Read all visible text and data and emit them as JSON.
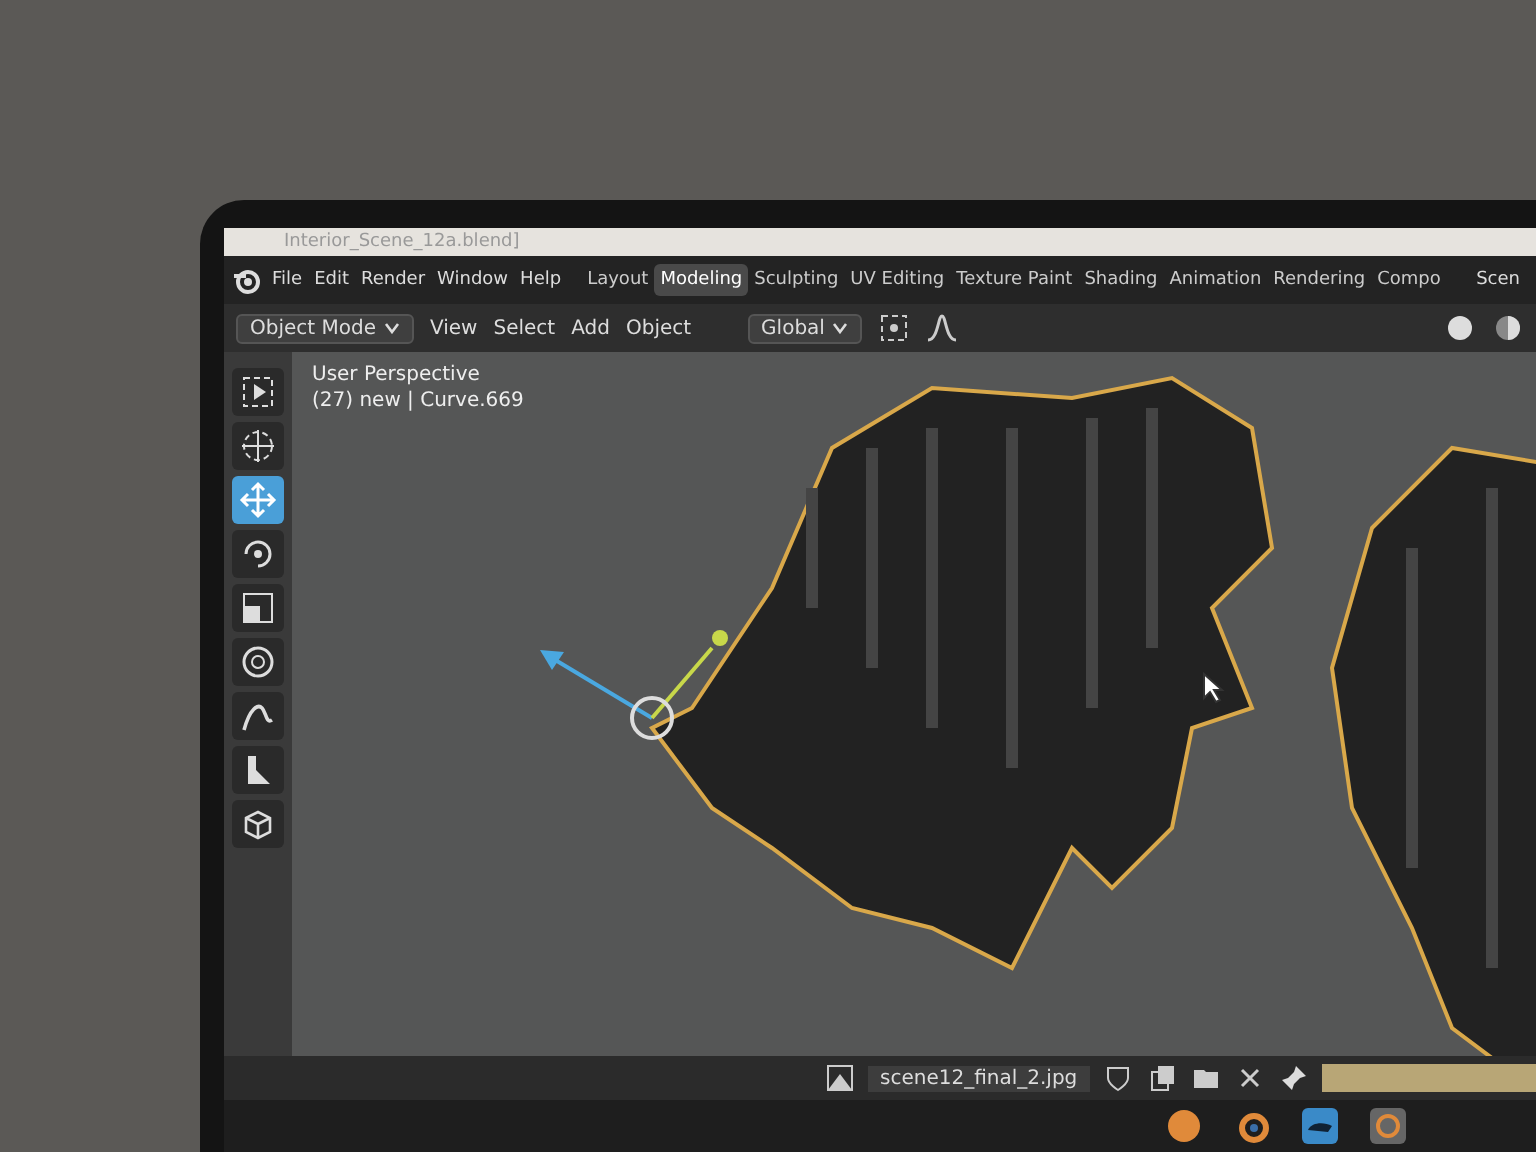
{
  "window": {
    "title": "Interior_Scene_12a.blend]"
  },
  "menu": [
    "File",
    "Edit",
    "Render",
    "Window",
    "Help"
  ],
  "workspace_tabs": [
    {
      "label": "Layout",
      "selected": false
    },
    {
      "label": "Modeling",
      "selected": true
    },
    {
      "label": "Sculpting",
      "selected": false
    },
    {
      "label": "UV Editing",
      "selected": false
    },
    {
      "label": "Texture Paint",
      "selected": false
    },
    {
      "label": "Shading",
      "selected": false
    },
    {
      "label": "Animation",
      "selected": false
    },
    {
      "label": "Rendering",
      "selected": false
    },
    {
      "label": "Compo",
      "selected": false
    }
  ],
  "scene_field": {
    "value": "Scen"
  },
  "header": {
    "mode": "Object Mode",
    "menus": [
      "View",
      "Select",
      "Add",
      "Object"
    ],
    "orientation": "Global"
  },
  "viewport": {
    "view_name": "User Perspective",
    "object_info": "(27) new | Curve.669"
  },
  "tools": [
    {
      "kind": "select",
      "selected": false
    },
    {
      "kind": "cursor",
      "selected": false
    },
    {
      "kind": "move",
      "selected": true
    },
    {
      "kind": "rotate",
      "selected": false
    },
    {
      "kind": "scale",
      "selected": false
    },
    {
      "kind": "transform",
      "selected": false
    },
    {
      "kind": "annotate",
      "selected": false
    },
    {
      "kind": "measure",
      "selected": false
    },
    {
      "kind": "add-cube",
      "selected": false
    }
  ],
  "image_bar": {
    "filename": "scene12_final_2.jpg"
  }
}
